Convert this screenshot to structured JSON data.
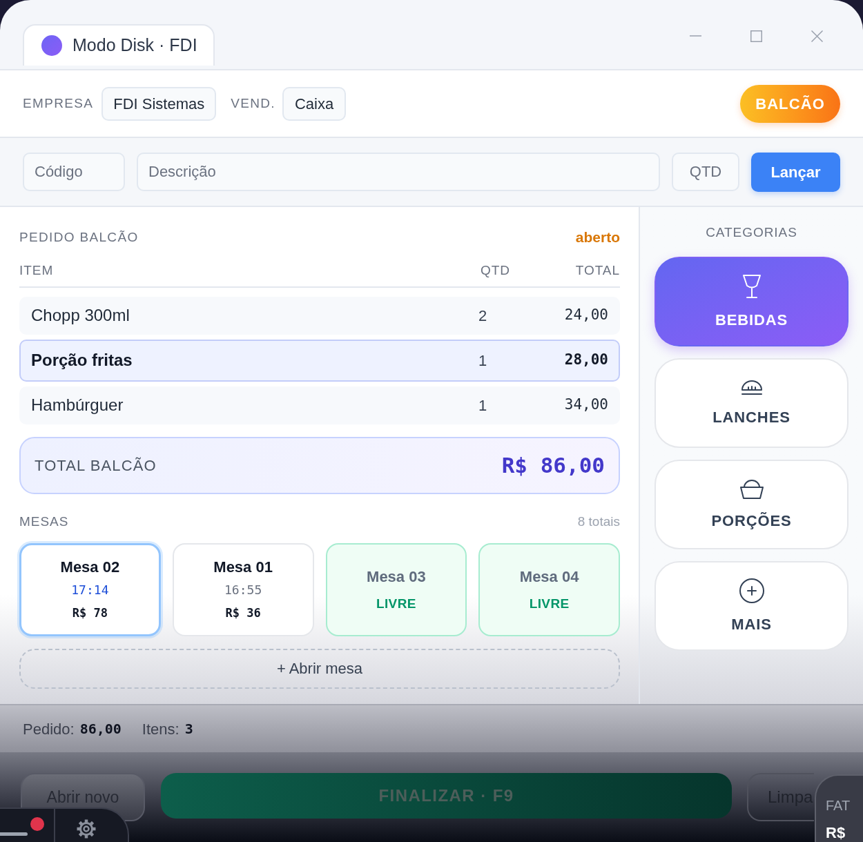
{
  "window": {
    "title": "Modo Disk · FDI"
  },
  "header": {
    "company_label": "EMPRESA",
    "company": "FDI Sistemas",
    "seller_label": "VEND.",
    "seller": "Caixa",
    "mode_button": "BALCÃO"
  },
  "entry": {
    "code": {
      "placeholder": "Código"
    },
    "description": {
      "placeholder": "Descrição"
    },
    "quantity": {
      "placeholder": "QTD"
    },
    "submit_button": "Lançar"
  },
  "order": {
    "title": "PEDIDO BALCÃO",
    "status": "aberto",
    "columns": [
      "ITEM",
      "QTD",
      "TOTAL"
    ],
    "rows": [
      {
        "item": "Chopp 300ml",
        "qty": "2",
        "total": "24,00",
        "selected": false
      },
      {
        "item": "Porção fritas",
        "qty": "1",
        "total": "28,00",
        "selected": true
      },
      {
        "item": "Hambúrguer",
        "qty": "1",
        "total": "34,00",
        "selected": false
      }
    ],
    "total_label": "TOTAL BALCÃO",
    "total_value": "R$ 86,00"
  },
  "tables": {
    "title": "MESAS",
    "count": "8 totais",
    "items": [
      {
        "name": "Mesa 02",
        "kind": "occupied",
        "time": "17:14",
        "amount": "R$ 78",
        "selected": true
      },
      {
        "name": "Mesa 01",
        "kind": "occupied",
        "time": "16:55",
        "amount": "R$ 36",
        "selected": false
      },
      {
        "name": "Mesa 03",
        "kind": "free",
        "status": "LIVRE",
        "selected": false
      },
      {
        "name": "Mesa 04",
        "kind": "free",
        "status": "LIVRE",
        "selected": false
      }
    ],
    "open_button": "+ Abrir mesa"
  },
  "categories": {
    "title": "CATEGORIAS",
    "items": [
      {
        "label": "BEBIDAS",
        "kind": "drinks",
        "selected": true
      },
      {
        "label": "LANCHES",
        "kind": "burgers",
        "selected": false
      },
      {
        "label": "PORÇÕES",
        "kind": "portions",
        "selected": false
      },
      {
        "label": "MAIS",
        "kind": "more",
        "selected": false
      }
    ]
  },
  "status_bar": {
    "order_label": "Pedido:",
    "order_value": "86,00",
    "items_label": "Itens:",
    "items_value": "3"
  },
  "actions": [
    {
      "label": "Abrir novo",
      "kind": "secondary"
    },
    {
      "label": "FINALIZAR · F9",
      "kind": "primary"
    },
    {
      "label": "Limpa",
      "kind": "ghost"
    }
  ],
  "overlay_panel": {
    "label": "FAT",
    "value": "R$"
  }
}
